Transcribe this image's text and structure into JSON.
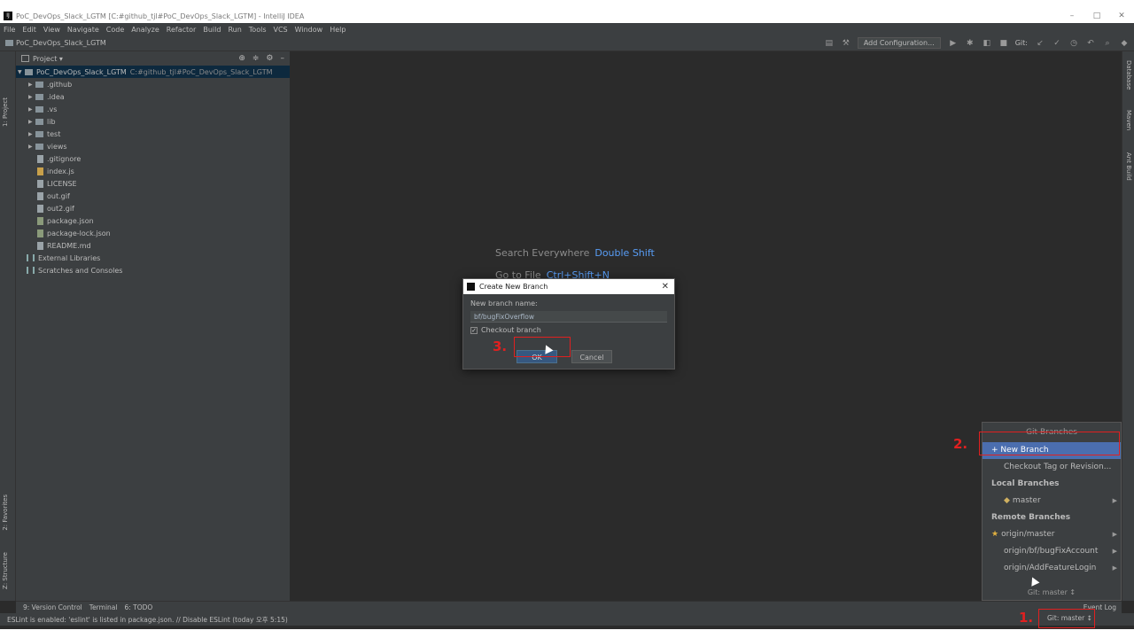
{
  "window": {
    "title": "PoC_DevOps_Slack_LGTM [C:#github_tjl#PoC_DevOps_Slack_LGTM] - IntelliJ IDEA",
    "controls": [
      "–",
      "□",
      "✕"
    ]
  },
  "menu": [
    "File",
    "Edit",
    "View",
    "Navigate",
    "Code",
    "Analyze",
    "Refactor",
    "Build",
    "Run",
    "Tools",
    "VCS",
    "Window",
    "Help"
  ],
  "breadcrumb": "PoC_DevOps_Slack_LGTM",
  "toolbar": {
    "add_configuration": "Add Configuration...",
    "git_label": "Git:"
  },
  "project_panel": {
    "title": "Project ▾",
    "root": {
      "name": "PoC_DevOps_Slack_LGTM",
      "path": "C:#github_tjl#PoC_DevOps_Slack_LGTM"
    },
    "folders": [
      ".github",
      ".idea",
      ".vs",
      "lib",
      "test",
      "views"
    ],
    "files": [
      ".gitignore",
      "index.js",
      "LICENSE",
      "out.gif",
      "out2.gif",
      "package.json",
      "package-lock.json",
      "README.md"
    ],
    "extras": [
      "External Libraries",
      "Scratches and Consoles"
    ]
  },
  "left_tabs": [
    "1: Project",
    "2: Favorites",
    "Z: Structure"
  ],
  "right_tabs": [
    "Database",
    "Maven",
    "Ant Build"
  ],
  "editor_hints": [
    {
      "label": "Search Everywhere",
      "key": "Double Shift"
    },
    {
      "label": "Go to File",
      "key": "Ctrl+Shift+N"
    }
  ],
  "dialog": {
    "title": "Create New Branch",
    "field_label": "New branch name:",
    "field_value": "bf/bugFixOverflow",
    "checkbox_label": "Checkout branch",
    "checkbox_checked": true,
    "ok_label": "OK",
    "cancel_label": "Cancel"
  },
  "git_popup": {
    "header": "Git Branches",
    "new_branch": "+ New Branch",
    "checkout_tag": "Checkout Tag or Revision...",
    "local_title": "Local Branches",
    "local": [
      "master"
    ],
    "remote_title": "Remote Branches",
    "remote": [
      "origin/master",
      "origin/bf/bugFixAccount",
      "origin/AddFeatureLogin"
    ],
    "footer": "Git: master ↕"
  },
  "bottom_tools": [
    "9: Version Control",
    "Terminal",
    "6: TODO"
  ],
  "event_log": "Event Log",
  "status": {
    "message": "ESLint is enabled: 'eslint' is listed in package.json. // Disable ESLint (today 오후 5:15)",
    "git_branch": "Git: master ↕"
  },
  "annotations": {
    "step1": "1.",
    "step2": "2.",
    "step3": "3."
  },
  "colors": {
    "annotation": "#e02020",
    "selection": "#4b6eaf",
    "link": "#589df6"
  }
}
